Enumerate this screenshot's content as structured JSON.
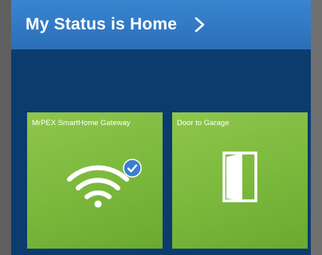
{
  "header": {
    "title": "My Status is Home",
    "chevron_icon": "chevron-right-icon"
  },
  "tiles": [
    {
      "label": "MrPEX SmartHome Gateway",
      "icon": "wifi-icon",
      "badge": "check-badge-icon",
      "color": "#7ab83c"
    },
    {
      "label": "Door to Garage",
      "icon": "door-icon",
      "color": "#7ab83c"
    }
  ],
  "colors": {
    "header": "#2f78c2",
    "background": "#0c3c6e",
    "tile": "#7ab83c",
    "badge": "#3a7fd0"
  }
}
